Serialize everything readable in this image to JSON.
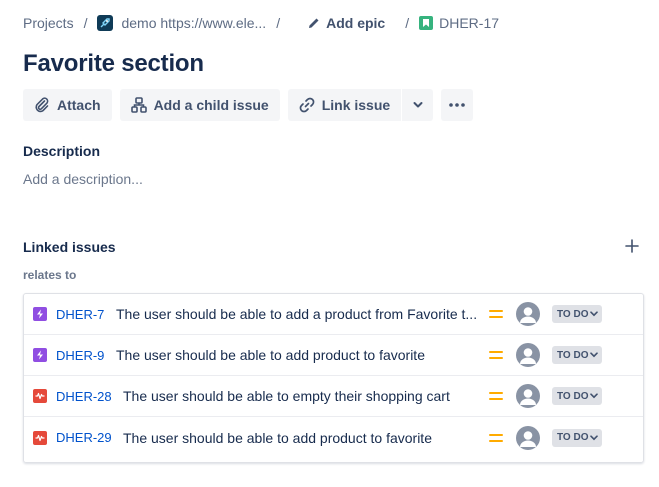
{
  "breadcrumb": {
    "projects": "Projects",
    "separator": "/",
    "project": "demo https://www.ele...",
    "epic": "Add epic",
    "issue_key": "DHER-17"
  },
  "issue": {
    "title": "Favorite section"
  },
  "toolbar": {
    "attach": "Attach",
    "add_child": "Add a child issue",
    "link_issue": "Link issue"
  },
  "description": {
    "heading": "Description",
    "placeholder": "Add a description..."
  },
  "linked": {
    "heading": "Linked issues",
    "relation": "relates to",
    "items": [
      {
        "key": "DHER-7",
        "type": "subtask",
        "summary": "The user should be able to add a product from Favorite t...",
        "priority": "medium",
        "status": "TO DO"
      },
      {
        "key": "DHER-9",
        "type": "subtask",
        "summary": "The user should be able to add product to favorite",
        "priority": "medium",
        "status": "TO DO"
      },
      {
        "key": "DHER-28",
        "type": "bug",
        "summary": "The user should be able to empty their shopping cart",
        "priority": "medium",
        "status": "TO DO"
      },
      {
        "key": "DHER-29",
        "type": "bug",
        "summary": "The user should be able to add product to favorite",
        "priority": "medium",
        "status": "TO DO"
      }
    ]
  },
  "colors": {
    "subtask": "#904ee2",
    "bug": "#e5493a",
    "story": "#36b37e",
    "link": "#0052cc",
    "priority_medium": "#ffab00"
  }
}
